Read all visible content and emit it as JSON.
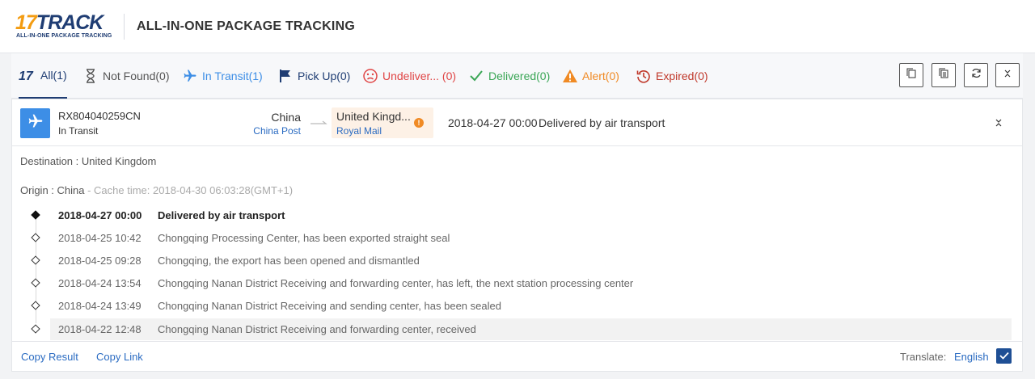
{
  "header": {
    "logo_num": "17",
    "logo_word": "TRACK",
    "logo_tagline": "ALL-IN-ONE PACKAGE TRACKING",
    "title": "ALL-IN-ONE PACKAGE TRACKING"
  },
  "tabs": [
    {
      "icon": "seventeen-logo-icon",
      "label": "All(1)",
      "color": "#1f3d73"
    },
    {
      "icon": "hourglass-icon",
      "label": "Not Found(0)",
      "color": "#555555"
    },
    {
      "icon": "airplane-icon",
      "label": "In Transit(1)",
      "color": "#3d8ee6"
    },
    {
      "icon": "flag-icon",
      "label": "Pick Up(0)",
      "color": "#1f3d73"
    },
    {
      "icon": "sad-face-icon",
      "label": "Undeliver... (0)",
      "color": "#e04545"
    },
    {
      "icon": "checkmark-icon",
      "label": "Delivered(0)",
      "color": "#3aa655"
    },
    {
      "icon": "warning-icon",
      "label": "Alert(0)",
      "color": "#f08a24"
    },
    {
      "icon": "history-icon",
      "label": "Expired(0)",
      "color": "#c0392b"
    }
  ],
  "toolbar": {
    "icons": [
      "copy-icon",
      "copy-list-icon",
      "refresh-icon",
      "collapse-all-icon"
    ]
  },
  "shipment": {
    "tracking_number": "RX804040259CN",
    "status": "In Transit",
    "origin_country": "China",
    "origin_carrier": "China Post",
    "destination_country": "United Kingd...",
    "destination_carrier": "Royal Mail",
    "latest_time": "2018-04-27 00:00",
    "latest_event": "Delivered by air transport",
    "destination_line": "Destination : United Kingdom",
    "origin_label": "Origin : China",
    "cache_time": " - Cache time: 2018-04-30 06:03:28(GMT+1)"
  },
  "events": [
    {
      "time": "2018-04-27 00:00",
      "desc": "Delivered by air transport"
    },
    {
      "time": "2018-04-25 10:42",
      "desc": "Chongqing Processing Center, has been exported straight seal"
    },
    {
      "time": "2018-04-25 09:28",
      "desc": "Chongqing, the export has been opened and dismantled"
    },
    {
      "time": "2018-04-24 13:54",
      "desc": "Chongqing Nanan District Receiving and forwarding center, has left, the next station processing center"
    },
    {
      "time": "2018-04-24 13:49",
      "desc": "Chongqing Nanan District Receiving and sending center, has been sealed"
    },
    {
      "time": "2018-04-22 12:48",
      "desc": "Chongqing Nanan District Receiving and forwarding center, received"
    }
  ],
  "footer": {
    "copy_result": "Copy Result",
    "copy_link": "Copy Link",
    "translate_label": "Translate:",
    "translate_lang": "English"
  },
  "colors": {
    "brand_navy": "#1f3d73",
    "brand_orange": "#f39c12",
    "link_blue": "#2a6bc2",
    "transit_blue": "#3d8ee6"
  }
}
